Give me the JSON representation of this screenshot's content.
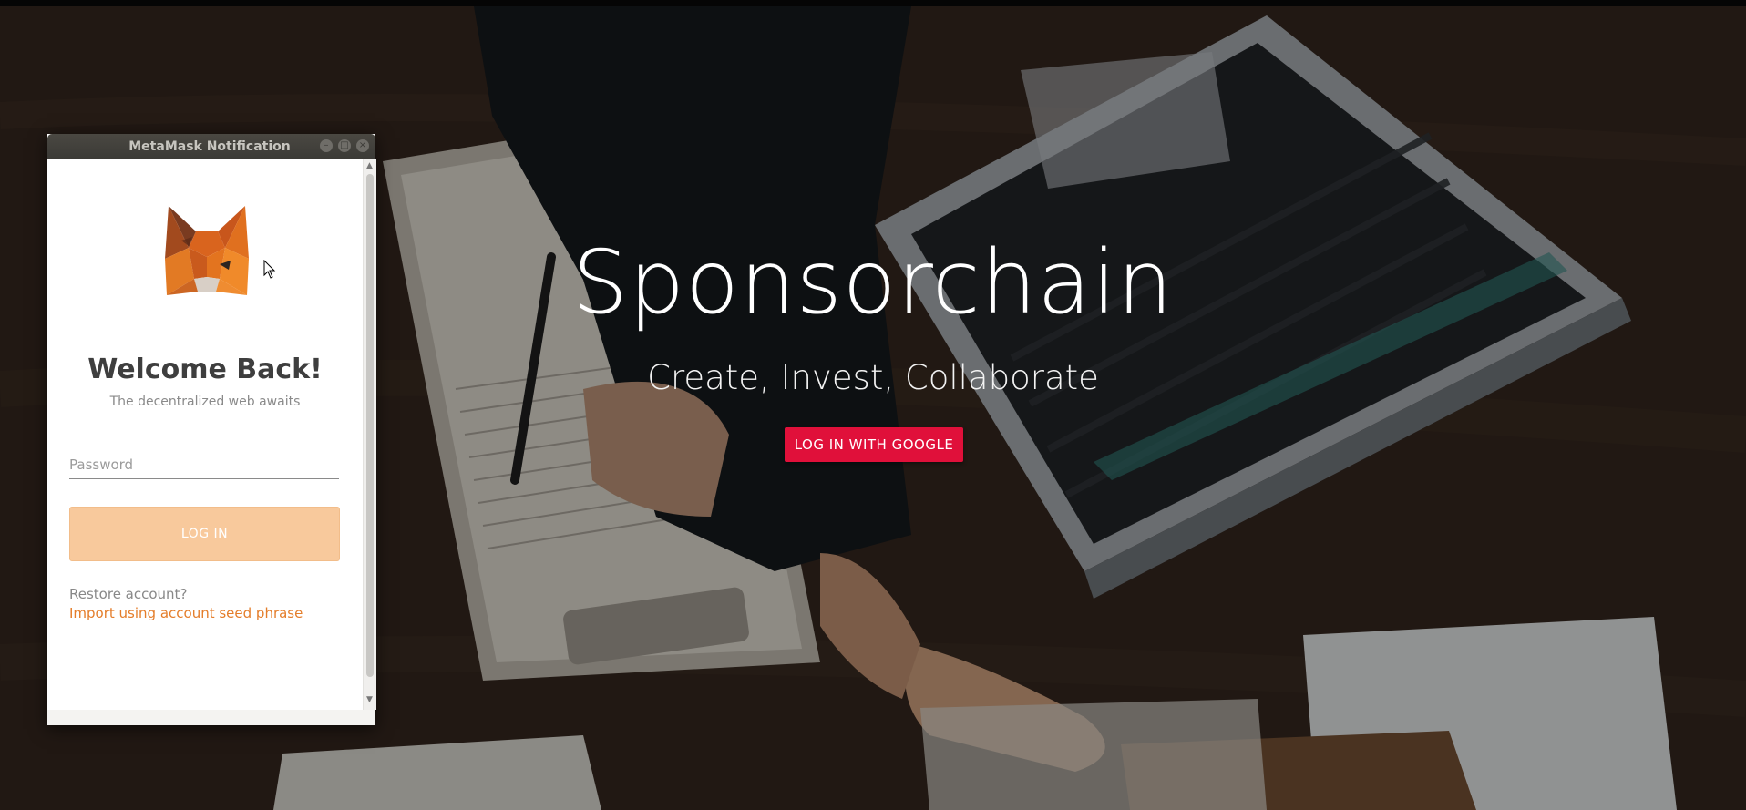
{
  "hero": {
    "title": "Sponsorchain",
    "subtitle": "Create, Invest, Collaborate",
    "google_button": "LOG IN WITH GOOGLE"
  },
  "metamask": {
    "window_title": "MetaMask Notification",
    "logo_icon": "metamask-fox-icon",
    "welcome_title": "Welcome Back!",
    "welcome_subtitle": "The decentralized web awaits",
    "password_placeholder": "Password",
    "login_button": "LOG IN",
    "restore_label": "Restore account?",
    "import_link": "Import using account seed phrase"
  },
  "colors": {
    "google_button": "#e0103a",
    "login_button": "#f8c99c",
    "import_link": "#e47d2a"
  }
}
